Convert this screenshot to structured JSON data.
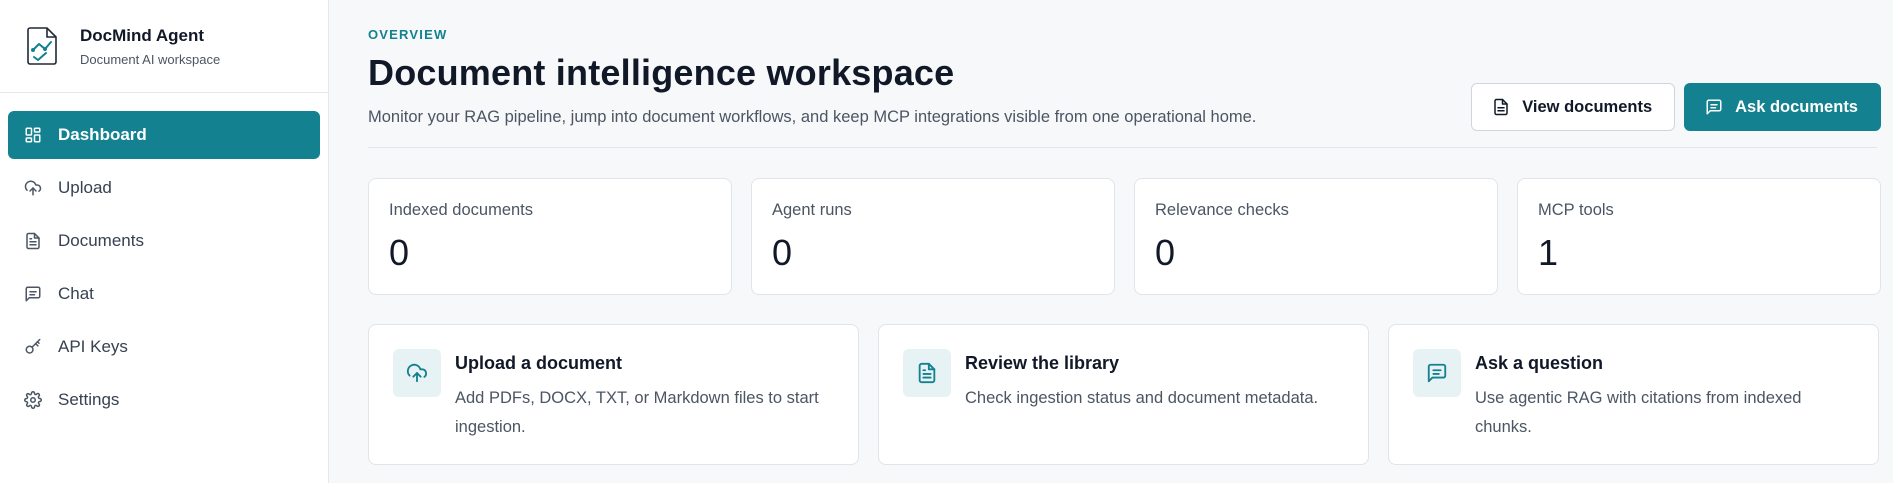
{
  "brand": {
    "title": "DocMind Agent",
    "subtitle": "Document AI workspace",
    "logo_icon": "document-chart-icon"
  },
  "sidebar": {
    "items": [
      {
        "label": "Dashboard",
        "icon": "dashboard-icon",
        "active": true
      },
      {
        "label": "Upload",
        "icon": "upload-cloud-icon",
        "active": false
      },
      {
        "label": "Documents",
        "icon": "document-icon",
        "active": false
      },
      {
        "label": "Chat",
        "icon": "chat-icon",
        "active": false
      },
      {
        "label": "API Keys",
        "icon": "key-icon",
        "active": false
      },
      {
        "label": "Settings",
        "icon": "gear-icon",
        "active": false
      }
    ]
  },
  "header": {
    "eyebrow": "OVERVIEW",
    "title": "Document intelligence workspace",
    "subtitle": "Monitor your RAG pipeline, jump into document workflows, and keep MCP integrations visible from one operational home.",
    "view_documents_label": "View documents",
    "ask_documents_label": "Ask documents"
  },
  "stats": [
    {
      "label": "Indexed documents",
      "value": "0"
    },
    {
      "label": "Agent runs",
      "value": "0"
    },
    {
      "label": "Relevance checks",
      "value": "0"
    },
    {
      "label": "MCP tools",
      "value": "1"
    }
  ],
  "actions": [
    {
      "title": "Upload a document",
      "description": "Add PDFs, DOCX, TXT, or Markdown files to start ingestion.",
      "icon": "upload-cloud-icon"
    },
    {
      "title": "Review the library",
      "description": "Check ingestion status and document metadata.",
      "icon": "document-icon"
    },
    {
      "title": "Ask a question",
      "description": "Use agentic RAG with citations from indexed chunks.",
      "icon": "chat-icon"
    }
  ],
  "colors": {
    "accent": "#13818f",
    "accent_soft": "#e6f2f3",
    "background": "#f7f8f9"
  }
}
